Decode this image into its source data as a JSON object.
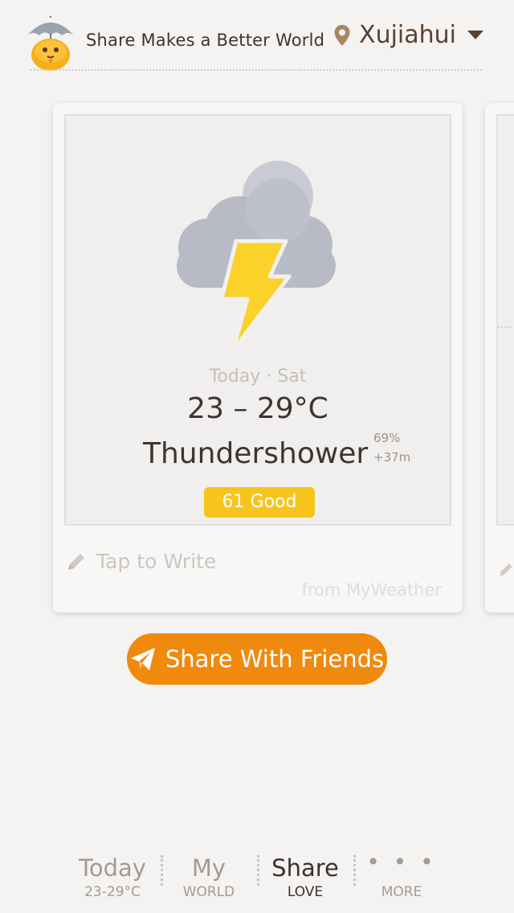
{
  "header": {
    "slogan": "Share Makes a Better World",
    "location": "Xujiahui"
  },
  "card": {
    "icon": "thunderstorm-icon",
    "day_label": "Today · Sat",
    "temperature": "23 – 29°C",
    "condition": "Thundershower",
    "humidity": "69%",
    "sunrise_delta": "+37m",
    "aqi": "61 Good",
    "write_placeholder": "Tap to Write",
    "source": "from MyWeather"
  },
  "share_button": {
    "label": "Share With Friends"
  },
  "tabs": [
    {
      "title": "Today",
      "subtitle": "23-29°C",
      "active": false
    },
    {
      "title": "My",
      "subtitle": "WORLD",
      "active": false
    },
    {
      "title": "Share",
      "subtitle": "LOVE",
      "active": true
    },
    {
      "title": "• • •",
      "subtitle": "MORE",
      "active": false
    }
  ],
  "colors": {
    "accent": "#ef8a0e",
    "aqi_badge": "#f7c41c",
    "lightning": "#fbd12a",
    "cloud": "#b9bcc6",
    "text_dark": "#3e3430"
  }
}
